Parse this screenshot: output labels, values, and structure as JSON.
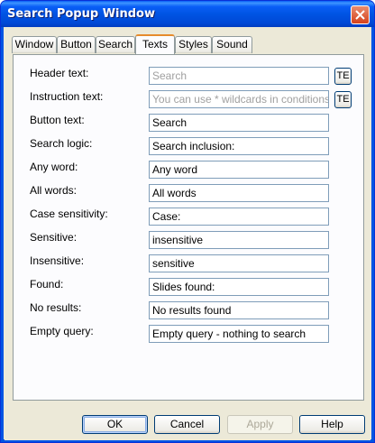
{
  "window": {
    "title": "Search Popup Window"
  },
  "tabs": [
    {
      "label": "Window"
    },
    {
      "label": "Button"
    },
    {
      "label": "Search"
    },
    {
      "label": "Texts"
    },
    {
      "label": "Styles"
    },
    {
      "label": "Sound"
    }
  ],
  "active_tab": "Texts",
  "fields": {
    "header_text": {
      "label": "Header text:",
      "value": "Search",
      "dim": true
    },
    "instruction_text": {
      "label": "Instruction text:",
      "value": "You can use * wildcards in conditions an",
      "dim": true
    },
    "button_text": {
      "label": "Button text:",
      "value": "Search"
    },
    "search_logic": {
      "label": "Search logic:",
      "value": "Search inclusion:"
    },
    "any_word": {
      "label": "Any word:",
      "value": "Any word"
    },
    "all_words": {
      "label": "All words:",
      "value": "All words"
    },
    "case_sensitivity": {
      "label": "Case sensitivity:",
      "value": "Case:"
    },
    "sensitive": {
      "label": "Sensitive:",
      "value": "insensitive"
    },
    "insensitive": {
      "label": "Insensitive:",
      "value": "sensitive"
    },
    "found": {
      "label": "Found:",
      "value": "Slides found:"
    },
    "no_results": {
      "label": "No results:",
      "value": "No results found"
    },
    "empty_query": {
      "label": "Empty query:",
      "value": "Empty query - nothing to search"
    }
  },
  "te_button": "TE",
  "buttons": {
    "ok": "OK",
    "cancel": "Cancel",
    "apply": "Apply",
    "help": "Help"
  },
  "colors": {
    "titlebar": "#0054e3",
    "dialog_bg": "#ece9d8",
    "active_tab_accent": "#e68b2c",
    "field_border": "#7f9db9"
  }
}
